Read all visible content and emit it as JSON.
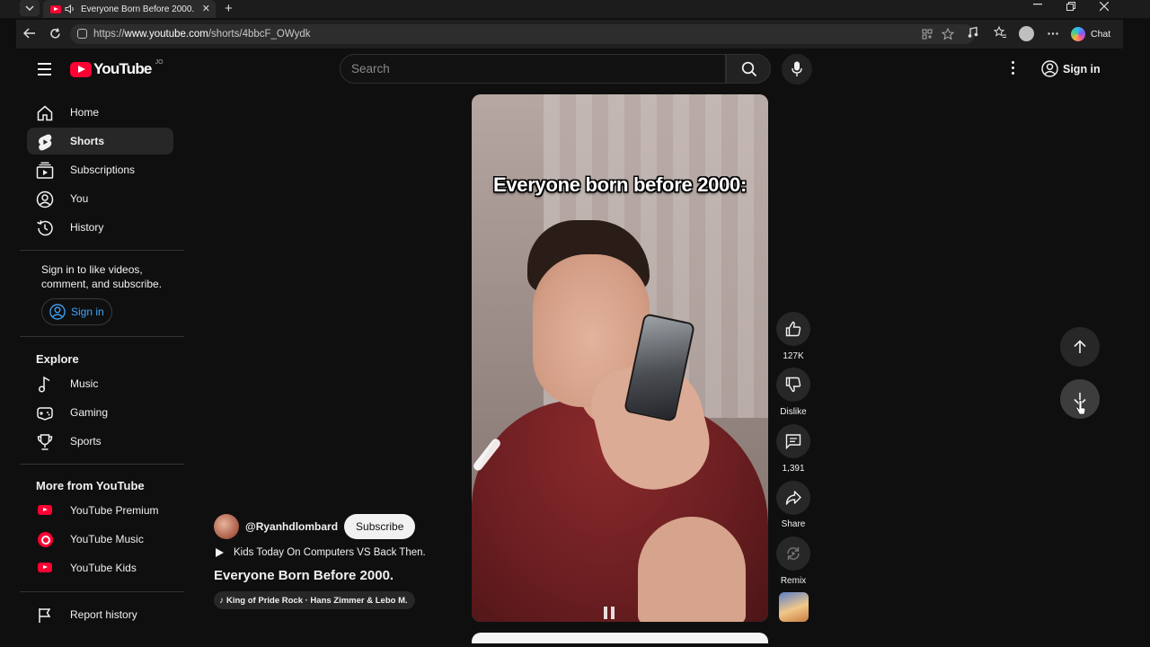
{
  "browser": {
    "tab_title": "Everyone Born Before 2000. -",
    "tab_close": "✕",
    "new_tab": "+",
    "url_prefix": "https://",
    "url_host": "www.youtube.com",
    "url_path": "/shorts/4bbcF_OWydk",
    "copilot_label": "Chat"
  },
  "masthead": {
    "logo_text": "YouTube",
    "country_code": "JO",
    "search_placeholder": "Search",
    "signin_label": "Sign in"
  },
  "sidebar": {
    "main": [
      {
        "label": "Home",
        "icon": "home-icon"
      },
      {
        "label": "Shorts",
        "icon": "shorts-icon",
        "active": true
      },
      {
        "label": "Subscriptions",
        "icon": "subscriptions-icon"
      },
      {
        "label": "You",
        "icon": "you-icon"
      },
      {
        "label": "History",
        "icon": "history-icon"
      }
    ],
    "signin_prompt": "Sign in to like videos, comment, and subscribe.",
    "signin_button": "Sign in",
    "explore_heading": "Explore",
    "explore": [
      {
        "label": "Music",
        "icon": "music-note-icon"
      },
      {
        "label": "Gaming",
        "icon": "gaming-icon"
      },
      {
        "label": "Sports",
        "icon": "trophy-icon"
      }
    ],
    "more_heading": "More from YouTube",
    "more": [
      {
        "label": "YouTube Premium",
        "icon": "youtube-premium-icon"
      },
      {
        "label": "YouTube Music",
        "icon": "youtube-music-icon"
      },
      {
        "label": "YouTube Kids",
        "icon": "youtube-kids-icon"
      }
    ],
    "report": {
      "label": "Report history",
      "icon": "flag-icon"
    }
  },
  "short": {
    "caption": "Everyone born before 2000:",
    "channel": "@Ryanhdlombard",
    "subscribe_label": "Subscribe",
    "playlist": "Kids Today On Computers VS Back Then.",
    "title": "Everyone Born Before 2000.",
    "music": "King of Pride Rock · Hans Zimmer & Lebo M."
  },
  "actions": {
    "likes": "127K",
    "dislike_label": "Dislike",
    "comments": "1,391",
    "share_label": "Share",
    "remix_label": "Remix"
  },
  "colors": {
    "background": "#0f0f0f",
    "brand_red": "#ff0033",
    "link_blue": "#3ea6ff",
    "surface": "#272727"
  }
}
